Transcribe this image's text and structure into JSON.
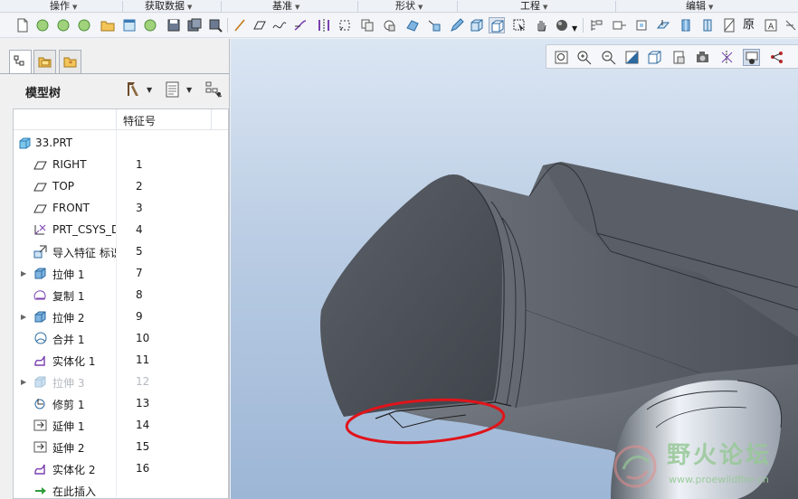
{
  "menu_groups": [
    {
      "label": "操作"
    },
    {
      "label": "获取数据"
    },
    {
      "label": "基准"
    },
    {
      "label": "形状"
    },
    {
      "label": "工程"
    },
    {
      "label": "编辑"
    }
  ],
  "toolbar": {
    "text_button": "原",
    "icons": [
      "new-file-icon",
      "regen-icon",
      "regen-icon",
      "regen-icon",
      "regen-icon",
      "open-folder-icon",
      "window-icon",
      "regen-icon",
      "save-icon",
      "save-copy-icon",
      "backup-icon",
      "sketch-line-icon",
      "plane-icon",
      "spline-icon",
      "curve-icon",
      "mirror-icon",
      "csys-icon",
      "copy-icon",
      "paste-icon",
      "sweep-icon",
      "point-icon",
      "edit-icon",
      "view-box-icon",
      "shaded-box-icon",
      "select-icon",
      "hand-icon",
      "sphere-icon",
      "dropdown-icon",
      "appearance-icon",
      "feature-icon",
      "measure-icon",
      "solid-icon",
      "ref-icon"
    ]
  },
  "left_panel": {
    "tabs": [
      "model-tree-tab",
      "folder-browser-tab",
      "favorites-tab"
    ],
    "title": "模型树",
    "column_header": "特征号"
  },
  "tree": {
    "root": {
      "label": "33.PRT",
      "icon": "part-icon"
    },
    "items": [
      {
        "label": "RIGHT",
        "num": "1",
        "icon": "datum-plane-icon",
        "expandable": false,
        "dim": false
      },
      {
        "label": "TOP",
        "num": "2",
        "icon": "datum-plane-icon",
        "expandable": false,
        "dim": false
      },
      {
        "label": "FRONT",
        "num": "3",
        "icon": "datum-plane-icon",
        "expandable": false,
        "dim": false
      },
      {
        "label": "PRT_CSYS_DEF",
        "num": "4",
        "icon": "csys-icon",
        "expandable": false,
        "dim": false
      },
      {
        "label": "导入特征 标识",
        "num": "5",
        "icon": "import-feature-icon",
        "expandable": false,
        "dim": false
      },
      {
        "label": "拉伸 1",
        "num": "7",
        "icon": "extrude-icon",
        "expandable": true,
        "dim": false
      },
      {
        "label": "复制 1",
        "num": "8",
        "icon": "copy-feature-icon",
        "expandable": false,
        "dim": false
      },
      {
        "label": "拉伸 2",
        "num": "9",
        "icon": "extrude-icon",
        "expandable": true,
        "dim": false
      },
      {
        "label": "合并 1",
        "num": "10",
        "icon": "merge-icon",
        "expandable": false,
        "dim": false
      },
      {
        "label": "实体化 1",
        "num": "11",
        "icon": "solidify-icon",
        "expandable": false,
        "dim": false
      },
      {
        "label": "拉伸 3",
        "num": "12",
        "icon": "extrude-icon",
        "expandable": true,
        "dim": true
      },
      {
        "label": "修剪 1",
        "num": "13",
        "icon": "trim-icon",
        "expandable": false,
        "dim": false
      },
      {
        "label": "延伸 1",
        "num": "14",
        "icon": "extend-icon",
        "expandable": false,
        "dim": false
      },
      {
        "label": "延伸 2",
        "num": "15",
        "icon": "extend-icon",
        "expandable": false,
        "dim": false
      },
      {
        "label": "实体化 2",
        "num": "16",
        "icon": "solidify-icon",
        "expandable": false,
        "dim": false
      },
      {
        "label": "在此插入",
        "num": "",
        "icon": "insert-here-arrow-icon",
        "expandable": false,
        "dim": false
      }
    ]
  },
  "view_toolbar": {
    "icons": [
      "refit-icon",
      "zoom-in-icon",
      "zoom-out-icon",
      "repaint-icon",
      "display-style-icon",
      "saved-views-icon",
      "view-manager-icon",
      "datum-display-icon",
      "annotation-display-icon",
      "spin-center-icon"
    ]
  },
  "watermark": {
    "title": "野火论坛",
    "url": "www.proewildfire.cn"
  },
  "colors": {
    "viewport_top": "#dbe6f3",
    "viewport_bottom": "#9db6d6",
    "model_dark": "#4a4f57",
    "highlight_circle": "#e0141b",
    "watermark_green": "#96c896"
  }
}
